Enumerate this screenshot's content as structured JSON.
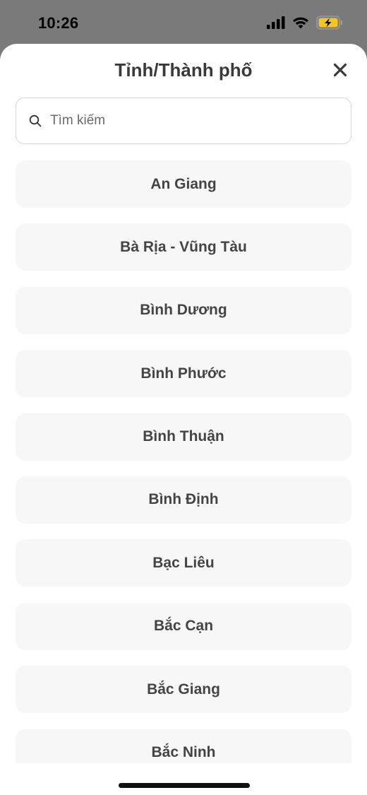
{
  "status_bar": {
    "time": "10:26",
    "icons": [
      "cellular-signal-icon",
      "wifi-icon",
      "battery-charging-icon"
    ],
    "battery_color": "#f4c527"
  },
  "sheet": {
    "title": "Tỉnh/Thành phố",
    "close_icon": "close-icon"
  },
  "search": {
    "placeholder": "Tìm kiếm",
    "value": ""
  },
  "provinces": [
    "An Giang",
    "Bà Rịa - Vũng Tàu",
    "Bình Dương",
    "Bình Phước",
    "Bình Thuận",
    "Bình Định",
    "Bạc Liêu",
    "Bắc Cạn",
    "Bắc Giang",
    "Bắc Ninh"
  ]
}
